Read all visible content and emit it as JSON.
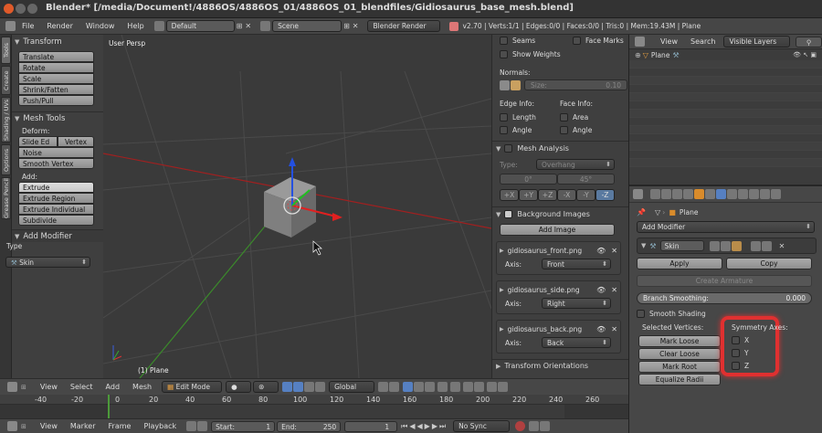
{
  "app": {
    "title": "Blender* [/media/Document!/4886OS/4886OS_01/4886OS_01_blendfiles/Gidiosaurus_base_mesh.blend]"
  },
  "menubar": {
    "items": [
      "File",
      "Render",
      "Window",
      "Help"
    ],
    "layout": "Default",
    "scene": "Scene",
    "engine": "Blender Render",
    "stats": "v2.70 | Verts:1/1 | Edges:0/0 | Faces:0/0 | Tris:0 | Mem:19.43M | Plane"
  },
  "toolshelf": {
    "tabs": [
      "Tools",
      "Create",
      "Shading / UVs",
      "Options",
      "Grease Pencil"
    ],
    "transform_title": "Transform",
    "transform_buttons": [
      "Translate",
      "Rotate",
      "Scale",
      "Shrink/Fatten",
      "Push/Pull"
    ],
    "mesh_tools_title": "Mesh Tools",
    "deform_label": "Deform:",
    "slide_edge": "Slide Ed",
    "vertex": "Vertex",
    "noise": "Noise",
    "smooth_vertex": "Smooth Vertex",
    "add_label": "Add:",
    "add_buttons": [
      "Extrude",
      "Extrude Region",
      "Extrude Individual",
      "Subdivide"
    ],
    "add_modifier_title": "Add Modifier",
    "type_label": "Type",
    "type_value": "Skin"
  },
  "viewport": {
    "label": "User Persp",
    "object_label": "(1) Plane"
  },
  "npanel": {
    "seams": "Seams",
    "face_marks": "Face Marks",
    "show_weights": "Show Weights",
    "normals_label": "Normals:",
    "size_label": "Size:",
    "size_value": "0.10",
    "edge_info": "Edge Info:",
    "face_info": "Face Info:",
    "length": "Length",
    "area": "Area",
    "angle1": "Angle",
    "angle2": "Angle",
    "mesh_analysis_title": "Mesh Analysis",
    "type_label": "Type:",
    "type_value": "Overhang",
    "angle_min": "0°",
    "angle_max": "45°",
    "axis_buttons": [
      "+X",
      "+Y",
      "+Z",
      "-X",
      "-Y",
      "-Z"
    ],
    "bg_images_title": "Background Images",
    "add_image": "Add Image",
    "images": [
      {
        "name": "gidiosaurus_front.png",
        "axis_label": "Axis:",
        "axis": "Front"
      },
      {
        "name": "gidiosaurus_side.png",
        "axis_label": "Axis:",
        "axis": "Right"
      },
      {
        "name": "gidiosaurus_back.png",
        "axis_label": "Axis:",
        "axis": "Back"
      }
    ],
    "transform_orientations": "Transform Orientations"
  },
  "outliner": {
    "view": "View",
    "search": "Search",
    "filter": "Visible Layers",
    "item": "Plane"
  },
  "properties": {
    "breadcrumb": "Plane",
    "add_modifier": "Add Modifier",
    "modifier_name": "Skin",
    "apply": "Apply",
    "copy": "Copy",
    "create_armature": "Create Armature",
    "branch_smoothing_label": "Branch Smoothing:",
    "branch_smoothing_value": "0.000",
    "smooth_shading": "Smooth Shading",
    "selected_vertices": "Selected Vertices:",
    "symmetry_axes": "Symmetry Axes:",
    "mark_loose": "Mark Loose",
    "clear_loose": "Clear Loose",
    "mark_root": "Mark Root",
    "equalize_radii": "Equalize Radii",
    "axis_x": "X",
    "axis_y": "Y",
    "axis_z": "Z",
    "highlight_color": "#e03030"
  },
  "viewport_header": {
    "items": [
      "View",
      "Select",
      "Add",
      "Mesh"
    ],
    "mode": "Edit Mode",
    "orientation": "Global"
  },
  "timeline": {
    "ticks": [
      "-40",
      "-20",
      "0",
      "20",
      "40",
      "60",
      "80",
      "100",
      "120",
      "140",
      "160",
      "180",
      "200",
      "220",
      "240",
      "260"
    ],
    "current_frame_marker_pos": 0
  },
  "timeline_header": {
    "items": [
      "View",
      "Marker",
      "Frame",
      "Playback"
    ],
    "start": "Start:",
    "start_value": "1",
    "end": "End:",
    "end_value": "250",
    "current": "1",
    "sync": "No Sync"
  }
}
